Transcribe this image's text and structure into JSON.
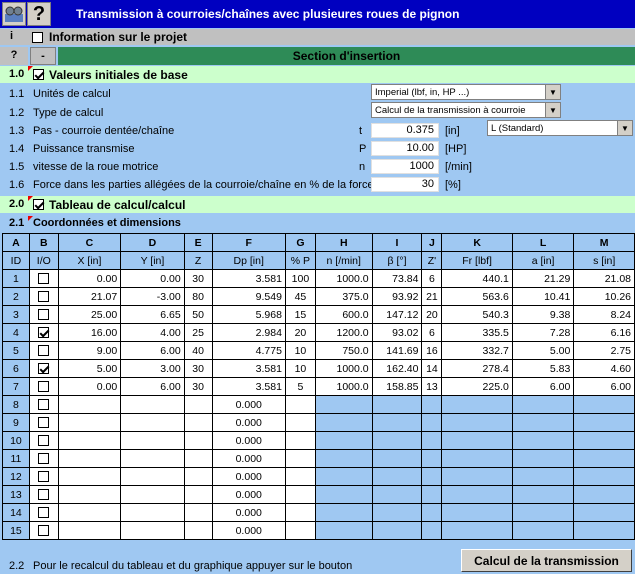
{
  "window": {
    "title": "Transmission à courroies/chaînes avec plusieures roues de pignon",
    "help_glyph": "?"
  },
  "info_row": {
    "marker": "i",
    "label": "Information sur le projet"
  },
  "insert_row": {
    "q": "?",
    "minus": "-",
    "label": "Section d'insertion"
  },
  "section1": {
    "num": "1.0",
    "label": "Valeurs initiales de base"
  },
  "params": [
    {
      "num": "1.1",
      "label": "Unités de calcul",
      "sym": "",
      "value": "Imperial (lbf, in, HP ...)",
      "unit": ""
    },
    {
      "num": "1.2",
      "label": "Type de calcul",
      "sym": "",
      "value": "Calcul de la transmission à courroie",
      "unit": ""
    },
    {
      "num": "1.3",
      "label": "Pas - courroie dentée/chaîne",
      "sym": "t",
      "value": "0.375",
      "unit": "[in]",
      "extra": "L (Standard)"
    },
    {
      "num": "1.4",
      "label": "Puissance transmise",
      "sym": "P",
      "value": "10.00",
      "unit": "[HP]"
    },
    {
      "num": "1.5",
      "label": "vitesse de la roue motrice",
      "sym": "n",
      "value": "1000",
      "unit": "[/min]"
    },
    {
      "num": "1.6",
      "label": "Force dans les parties allégées de la courroie/chaîne en % de la force",
      "sym": "",
      "value": "30",
      "unit": "[%]"
    }
  ],
  "section2": {
    "num": "2.0",
    "label": "Tableau de calcul/calcul"
  },
  "section21": {
    "num": "2.1",
    "label": "Coordonnées et dimensions"
  },
  "table": {
    "letters": [
      "A",
      "B",
      "C",
      "D",
      "E",
      "F",
      "G",
      "H",
      "I",
      "J",
      "K",
      "L",
      "M"
    ],
    "headers": [
      "ID",
      "I/O",
      "X [in]",
      "Y [in]",
      "Z",
      "Dp [in]",
      "% P",
      "n [/min]",
      "β [°]",
      "Z'",
      "Fr [lbf]",
      "a [in]",
      "s [in]"
    ],
    "rows": [
      {
        "id": "1",
        "io": false,
        "x": "0.00",
        "y": "0.00",
        "z": "30",
        "dp": "3.581",
        "p": "100",
        "n": "1000.0",
        "beta": "73.84",
        "z2": "6",
        "fr": "440.1",
        "a": "21.29",
        "s": "21.08"
      },
      {
        "id": "2",
        "io": false,
        "x": "21.07",
        "y": "-3.00",
        "z": "80",
        "dp": "9.549",
        "p": "45",
        "n": "375.0",
        "beta": "93.92",
        "z2": "21",
        "fr": "563.6",
        "a": "10.41",
        "s": "10.26"
      },
      {
        "id": "3",
        "io": false,
        "x": "25.00",
        "y": "6.65",
        "z": "50",
        "dp": "5.968",
        "p": "15",
        "n": "600.0",
        "beta": "147.12",
        "z2": "20",
        "fr": "540.3",
        "a": "9.38",
        "s": "8.24"
      },
      {
        "id": "4",
        "io": true,
        "x": "16.00",
        "y": "4.00",
        "z": "25",
        "dp": "2.984",
        "p": "20",
        "n": "1200.0",
        "beta": "93.02",
        "z2": "6",
        "fr": "335.5",
        "a": "7.28",
        "s": "6.16"
      },
      {
        "id": "5",
        "io": false,
        "x": "9.00",
        "y": "6.00",
        "z": "40",
        "dp": "4.775",
        "p": "10",
        "n": "750.0",
        "beta": "141.69",
        "z2": "16",
        "fr": "332.7",
        "a": "5.00",
        "s": "2.75"
      },
      {
        "id": "6",
        "io": true,
        "x": "5.00",
        "y": "3.00",
        "z": "30",
        "dp": "3.581",
        "p": "10",
        "n": "1000.0",
        "beta": "162.40",
        "z2": "14",
        "fr": "278.4",
        "a": "5.83",
        "s": "4.60"
      },
      {
        "id": "7",
        "io": false,
        "x": "0.00",
        "y": "6.00",
        "z": "30",
        "dp": "3.581",
        "p": "5",
        "n": "1000.0",
        "beta": "158.85",
        "z2": "13",
        "fr": "225.0",
        "a": "6.00",
        "s": "6.00"
      }
    ],
    "empty_ids": [
      "8",
      "9",
      "10",
      "11",
      "12",
      "13",
      "14",
      "15"
    ],
    "empty_dp": "0.000"
  },
  "footer": {
    "num": "2.2",
    "label": "Pour le recalcul du tableau et du graphique appuyer sur le bouton",
    "button": "Calcul de la transmission"
  },
  "colors": {
    "title_bg": "#0000c0",
    "body_bg": "#9fc8f2",
    "section_green": "#2e8b57",
    "light_green": "#ccffcc"
  }
}
